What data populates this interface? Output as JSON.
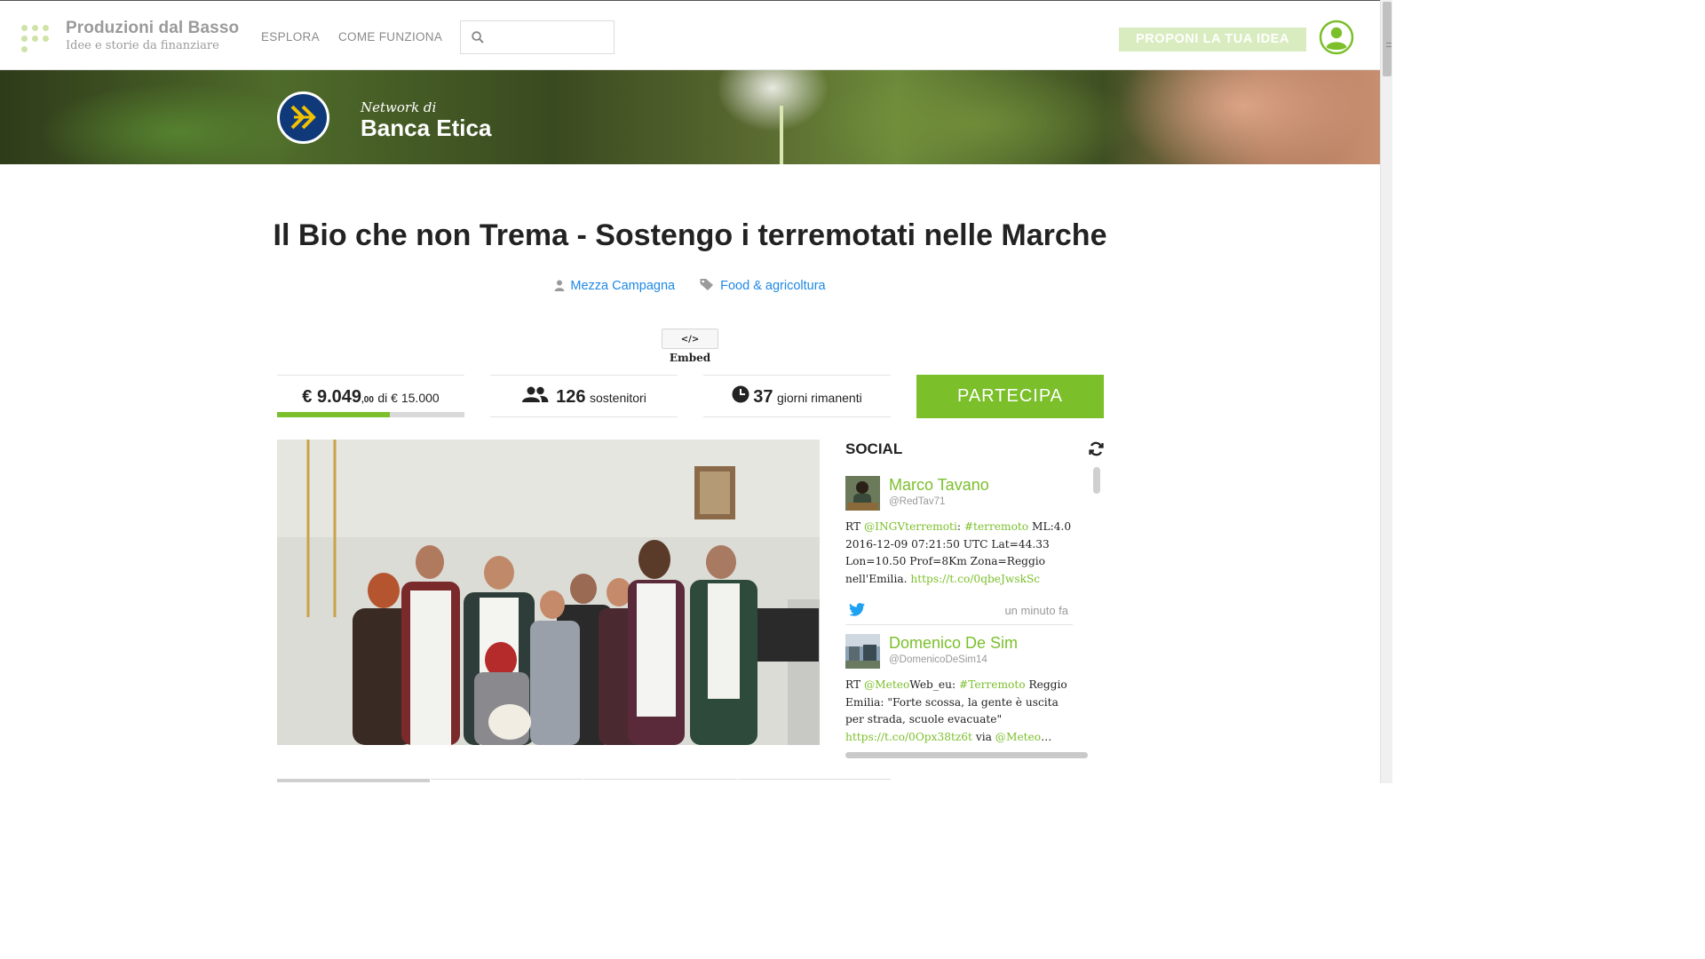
{
  "header": {
    "brand_name": "Produzioni dal Basso",
    "brand_tagline": "Idee e storie da finanziare",
    "nav": [
      "ESPLORA",
      "COME FUNZIONA"
    ],
    "search_placeholder": "",
    "propose_label": "PROPONI LA TUA IDEA",
    "brand_dot_color": "#cfe3a8",
    "accent": "#7bbf2a"
  },
  "banner": {
    "network_prefix": "Network di",
    "network_name": "Banca Etica",
    "badge_color": "#10397a",
    "badge_glyph_color": "#f2c100"
  },
  "project": {
    "title": "Il Bio che non Trema - Sostengo i terremotati nelle Marche",
    "author": "Mezza Campagna",
    "category": "Food & agricoltura",
    "embed_label": "Embed"
  },
  "stats": {
    "raised": "€ 9.049",
    "raised_cents": ",00",
    "goal_text": "di € 15.000",
    "progress_fraction": 0.6033,
    "supporters_count": "126",
    "supporters_label": "sostenitori",
    "days_count": "37",
    "days_label": "giorni rimanenti",
    "participate_label": "PARTECIPA"
  },
  "social": {
    "heading": "SOCIAL",
    "tweets": [
      {
        "name": "Marco Tavano",
        "handle": "@RedTav71",
        "parts": [
          {
            "t": "RT ",
            "link": false
          },
          {
            "t": "@INGVterremoti",
            "link": true
          },
          {
            "t": ": ",
            "link": false
          },
          {
            "t": "#terremoto",
            "link": true
          },
          {
            "t": " ML:4.0 2016-12-09 07:21:50 UTC Lat=44.33 Lon=10.50 Prof=8Km Zona=Reggio nell'Emilia. ",
            "link": false
          },
          {
            "t": "https://t.co/0qbeJwskSc",
            "link": true
          }
        ],
        "time": "un minuto fa"
      },
      {
        "name": "Domenico De Sim",
        "handle": "@DomenicoDeSim14",
        "parts": [
          {
            "t": "RT ",
            "link": false
          },
          {
            "t": "@Meteo",
            "link": true
          },
          {
            "t": "Web_eu: ",
            "link": false
          },
          {
            "t": "#Terremoto",
            "link": true
          },
          {
            "t": " Reggio Emilia: \"Forte scossa, la gente è uscita per strada, scuole evacuate\" ",
            "link": false
          },
          {
            "t": "https://t.co/0Opx38tz6t",
            "link": true
          },
          {
            "t": " via ",
            "link": false
          },
          {
            "t": "@Meteo",
            "link": true
          },
          {
            "t": "…",
            "link": false
          }
        ]
      }
    ]
  }
}
